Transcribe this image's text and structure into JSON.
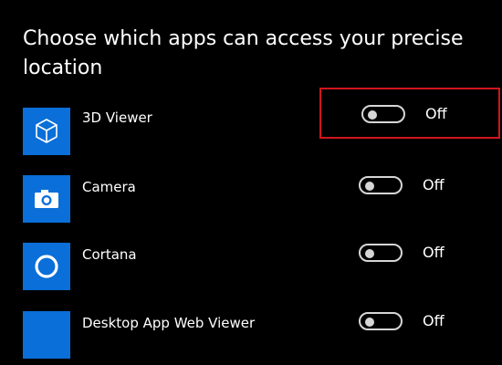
{
  "page": {
    "heading": "Choose which apps can access your precise location"
  },
  "apps": [
    {
      "name": "3D Viewer",
      "icon": "3d-cube-icon",
      "toggle": {
        "state_label": "Off",
        "on": false
      }
    },
    {
      "name": "Camera",
      "icon": "camera-icon",
      "toggle": {
        "state_label": "Off",
        "on": false
      }
    },
    {
      "name": "Cortana",
      "icon": "cortana-ring-icon",
      "toggle": {
        "state_label": "Off",
        "on": false
      }
    },
    {
      "name": "Desktop App Web Viewer",
      "icon": "blank-app-icon",
      "toggle": {
        "state_label": "Off",
        "on": false
      }
    }
  ],
  "colors": {
    "background": "#000000",
    "tile": "#0a6fd8",
    "toggle_off": "#d6d6d6",
    "highlight": "#d0161d",
    "text": "#ffffff"
  }
}
